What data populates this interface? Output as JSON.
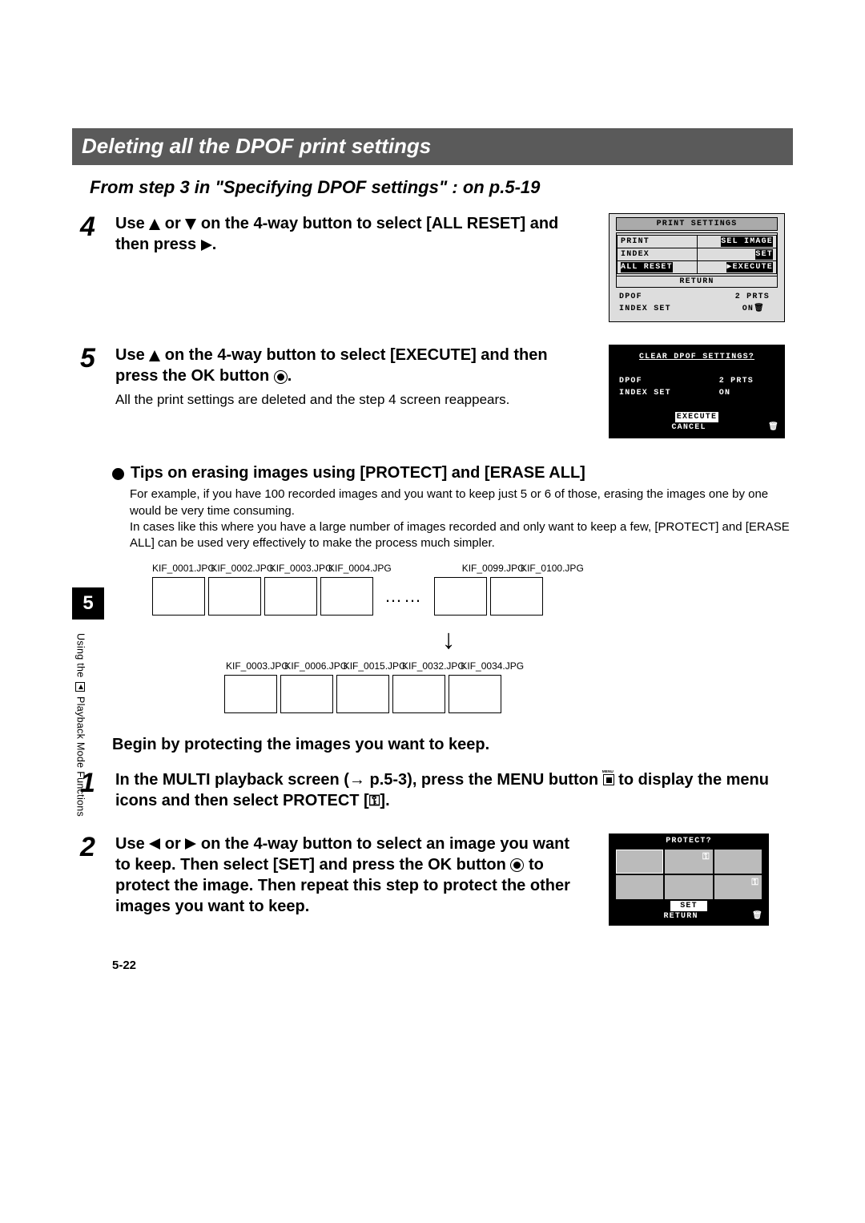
{
  "section_title": "Deleting all the DPOF print settings",
  "from_step": "From step 3 in \"Specifying DPOF settings\" : on p.5-19",
  "step4": {
    "line1_before": "Use ",
    "line1_mid": " or ",
    "line1_after": " on the 4-way button to select [ALL RESET] and then press ",
    "line1_end": "."
  },
  "lcd1": {
    "title": "PRINT SETTINGS",
    "rows": [
      [
        "PRINT",
        "SEL IMAGE"
      ],
      [
        "INDEX",
        "SET"
      ],
      [
        "ALL RESET",
        "▶EXECUTE"
      ]
    ],
    "return_label": "RETURN",
    "footer": [
      [
        "DPOF",
        "2 PRTS"
      ],
      [
        "INDEX SET",
        "ON"
      ]
    ]
  },
  "step5": {
    "line1": "Use ",
    "line1_after": " on the 4-way button to select [EXECUTE] and then press the OK button ",
    "line1_end": ".",
    "body": "All the print settings are deleted and the step 4 screen reappears."
  },
  "lcd2": {
    "title": "CLEAR DPOF SETTINGS?",
    "rows": [
      [
        "DPOF",
        "2 PRTS"
      ],
      [
        "INDEX SET",
        "ON"
      ]
    ],
    "execute": "EXECUTE",
    "cancel": "CANCEL"
  },
  "chapter_number": "5",
  "side_label_before": "Using the ",
  "side_label_after": " Playback Mode Functions",
  "tips_title": "Tips on erasing images using [PROTECT] and [ERASE ALL]",
  "tips_body": "For example, if you have 100 recorded images and you want to keep just 5 or 6 of those, erasing the images one by one would be very time consuming.\nIn cases like this where you have a large number of images recorded and only want to keep a few, [PROTECT] and [ERASE ALL] can be used very effectively to make the process much simpler.",
  "strip_top_labels": [
    "KIF_0001.JPG",
    "KIF_0002.JPG",
    "KIF_0003.JPG",
    "KIF_0004.JPG",
    "KIF_0099.JPG",
    "KIF_0100.JPG"
  ],
  "strip_bottom_labels": [
    "KIF_0003.JPG",
    "KIF_0006.JPG",
    "KIF_0015.JPG",
    "KIF_0032.JPG",
    "KIF_0034.JPG"
  ],
  "dots": "……",
  "begin_line": "Begin by protecting the images you want to keep.",
  "step1_text_a": "In the MULTI playback screen (→ p.5-3), press the MENU button ",
  "step1_text_b": " to display the menu icons and then select PROTECT [",
  "step1_text_c": "].",
  "step2_text_a": "Use ",
  "step2_text_mid": " or ",
  "step2_text_b": " on the 4-way button to select an image you want to keep. Then select [SET] and press the OK button ",
  "step2_text_c": " to protect the image. Then repeat this step to protect the other images you want to keep.",
  "protect_lcd": {
    "title": "PROTECT?",
    "set": "SET",
    "return": "RETURN"
  },
  "page_number": "5-22"
}
